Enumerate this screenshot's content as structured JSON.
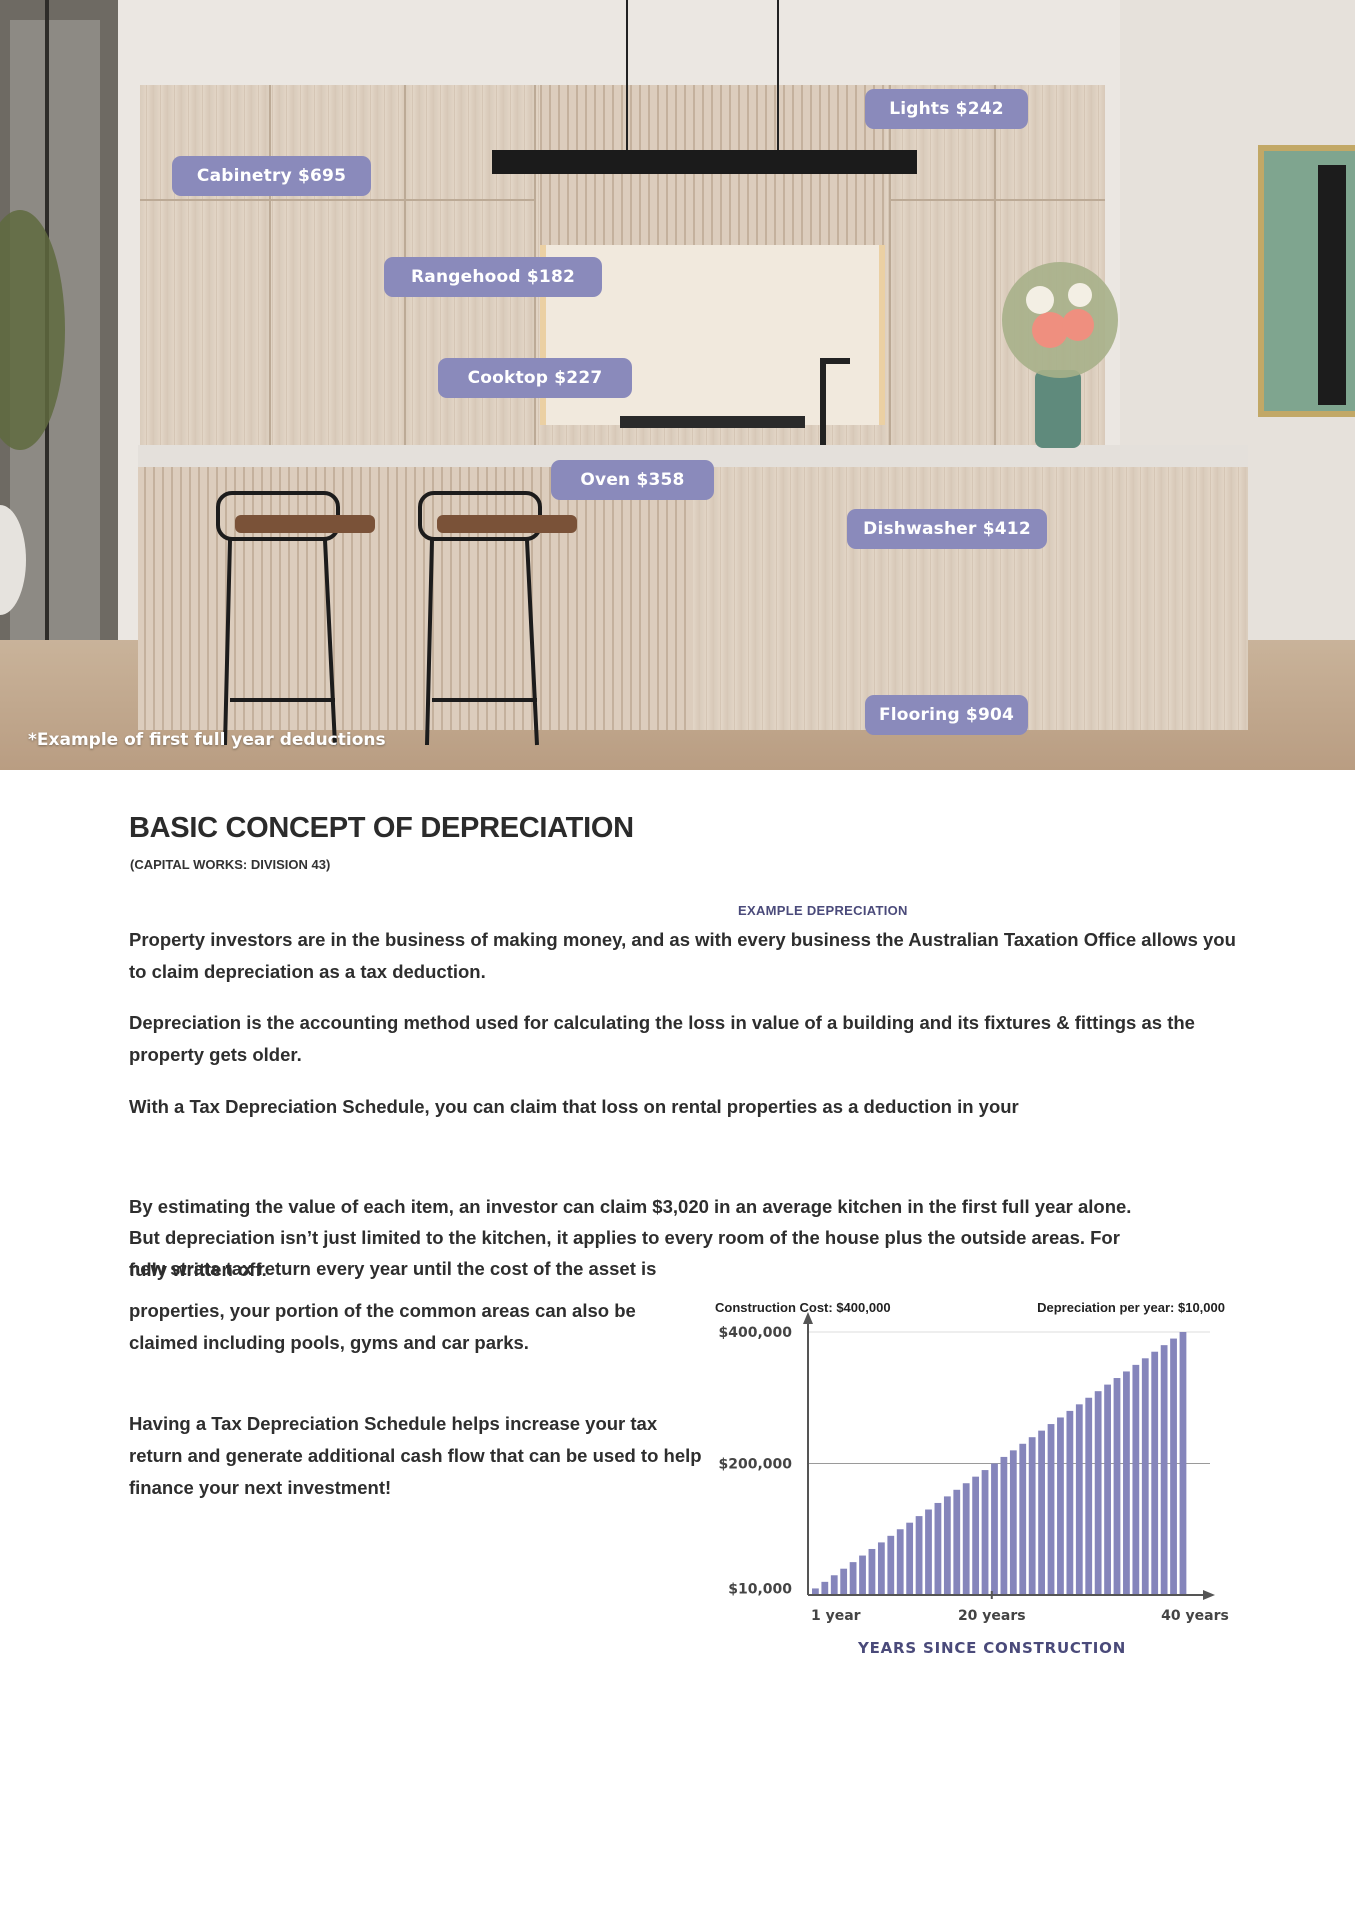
{
  "hero": {
    "tags": [
      {
        "label": "Cabinetry $695"
      },
      {
        "label": "Lights $242"
      },
      {
        "label": "Rangehood $182"
      },
      {
        "label": "Cooktop $227"
      },
      {
        "label": "Oven $358"
      },
      {
        "label": "Dishwasher $412"
      },
      {
        "label": "Flooring $904"
      }
    ],
    "footnote": "*Example of first full year deductions",
    "tag_color": "#8a8abb"
  },
  "content": {
    "title": "BASIC CONCEPT OF DEPRECIATION",
    "subtitle": "(CAPITAL WORKS: DIVISION 43)",
    "chart_heading": "EXAMPLE  DEPRECIATION",
    "p1": "Property investors are in the business of making money, and as with every business the Australian Taxation Office allows you to claim depreciation as a tax deduction.",
    "p2": "Depreciation is the accounting method used for calculating the loss in value of a building and its fixtures & fittings as the property gets older.",
    "p3": "With a Tax Depreciation Schedule, you can claim that loss on rental properties as a deduction in your",
    "p4": "By estimating the value of each item, an investor can claim $3,020 in an average kitchen in the first full year alone. But depreciation isn’t just limited to the kitchen, it applies to every room of the house plus the outside areas. For new strata tax return every year until the cost of the asset is",
    "p4b": "fully written off.",
    "p5": "properties, your portion of the common areas can also be claimed including pools, gyms and car parks.",
    "p6": "Having a Tax Depreciation Schedule helps increase your tax return and generate additional cash flow that can be used to help finance your next investment!"
  },
  "chart_data": {
    "type": "bar",
    "title": "EXAMPLE  DEPRECIATION",
    "annotations": [
      "Construction Cost: $400,000",
      "Depreciation per year: $10,000"
    ],
    "xlabel": "YEARS SINCE CONSTRUCTION",
    "ylabel": "",
    "y_tick_labels": [
      "$400,000",
      "$200,000",
      "$10,000"
    ],
    "x_tick_labels": [
      "1 year",
      "20 years",
      "40 years"
    ],
    "x": [
      1,
      2,
      3,
      4,
      5,
      6,
      7,
      8,
      9,
      10,
      11,
      12,
      13,
      14,
      15,
      16,
      17,
      18,
      19,
      20,
      21,
      22,
      23,
      24,
      25,
      26,
      27,
      28,
      29,
      30,
      31,
      32,
      33,
      34,
      35,
      36,
      37,
      38,
      39,
      40
    ],
    "values": [
      10000,
      20000,
      30000,
      40000,
      50000,
      60000,
      70000,
      80000,
      90000,
      100000,
      110000,
      120000,
      130000,
      140000,
      150000,
      160000,
      170000,
      180000,
      190000,
      200000,
      210000,
      220000,
      230000,
      240000,
      250000,
      260000,
      270000,
      280000,
      290000,
      300000,
      310000,
      320000,
      330000,
      340000,
      350000,
      360000,
      370000,
      380000,
      390000,
      400000
    ],
    "ylim": [
      0,
      400000
    ],
    "grid": true,
    "bar_color": "#8585bb",
    "label_color": "#4a4a7a"
  }
}
